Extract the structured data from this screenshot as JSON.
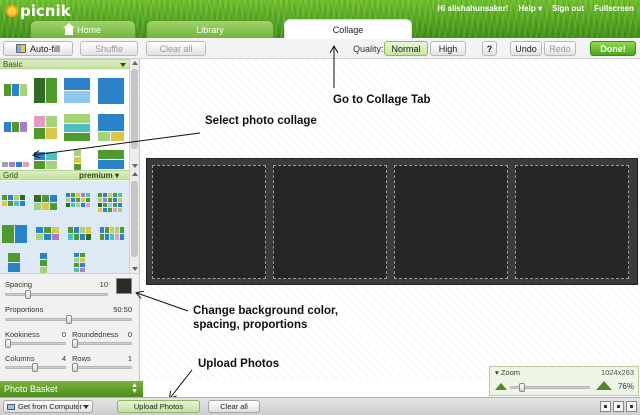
{
  "app": {
    "logo": "picnik",
    "user_links": [
      "Hi alishahunsaker!",
      "Help ▾",
      "Sign out",
      "Fullscreen"
    ]
  },
  "tabs": [
    {
      "label": "Home",
      "icon": "home-icon"
    },
    {
      "label": "Library"
    },
    {
      "label": "Collage",
      "active": true
    }
  ],
  "toolbar": {
    "autofill": "Auto-fill",
    "shuffle": "Shuffle",
    "clear_all": "Clear all",
    "quality_label": "Quality:",
    "quality_normal": "Normal",
    "quality_high": "High",
    "help": "?",
    "undo": "Undo",
    "redo": "Redo",
    "done": "Done!"
  },
  "left_panel": {
    "basic_header": "Basic",
    "grid_header": "Grid",
    "grid_premium": "premium ▾",
    "settings": {
      "spacing_label": "Spacing",
      "spacing_value": "10",
      "spacing_fraction": 0.2,
      "proportions_label": "Proportions",
      "proportions_value": "50:50",
      "proportions_fraction": 0.5,
      "kookiness_label": "Kookiness",
      "kookiness_value": "0",
      "roundedness_label": "Roundedness",
      "roundedness_value": "0",
      "columns_label": "Columns",
      "columns_value": "4",
      "rows_label": "Rows",
      "rows_value": "1",
      "background_color": "#2b2b2b"
    }
  },
  "basket": {
    "title": "Photo Basket",
    "get_from": "Get from Computer",
    "upload": "Upload Photos",
    "clear_all": "Clear all"
  },
  "zoom": {
    "label": "▾ Zoom",
    "size": "1024x263",
    "percent": "76%"
  },
  "annotations": {
    "collage_tab": "Go to Collage Tab",
    "select_collage": "Select photo collage",
    "background": "Change background color, spacing, proportions",
    "upload": "Upload Photos"
  },
  "colors": {
    "accent_green": "#4ea51a",
    "collage_bg": "#3b3b3b"
  }
}
